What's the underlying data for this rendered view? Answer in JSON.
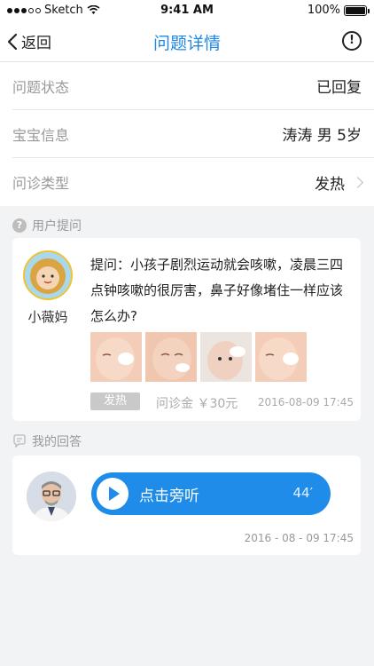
{
  "status_bar": {
    "carrier": "Sketch",
    "time": "9:41 AM",
    "battery": "100%"
  },
  "nav": {
    "back_label": "返回",
    "title": "问题详情"
  },
  "info_rows": [
    {
      "label": "问题状态",
      "value": "已回复"
    },
    {
      "label": "宝宝信息",
      "value": "涛涛  男  5岁"
    },
    {
      "label": "问诊类型",
      "value": "发热"
    }
  ],
  "question_section": {
    "header": "用户提问",
    "user_name": "小薇妈",
    "text": "提问：小孩子剧烈运动就会咳嗽，凌晨三四点钟咳嗽的很厉害，鼻子好像堵住一样应该怎么办?",
    "tag": "发热",
    "fee": "问诊金 ￥30元",
    "time": "2016-08-09  17:45"
  },
  "answer_section": {
    "header": "我的回答",
    "voice_label": "点击旁听",
    "duration": "44′",
    "time": "2016 - 08 - 09  17:45"
  },
  "colors": {
    "accent": "#1e88e5"
  }
}
